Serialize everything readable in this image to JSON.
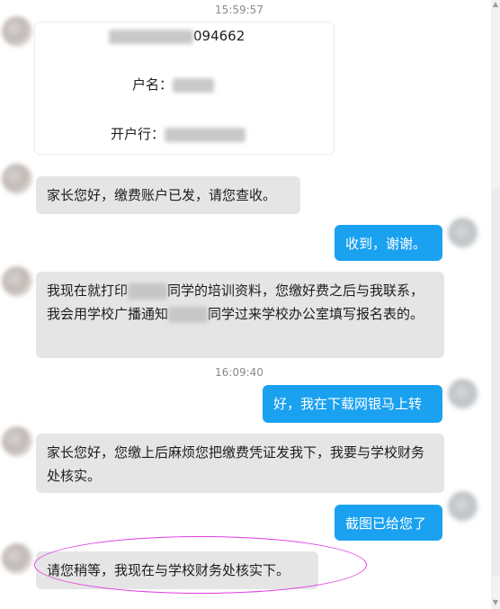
{
  "timestamps": [
    "15:59:57",
    "16:09:40"
  ],
  "card": {
    "account_suffix": "094662",
    "name_label": "户名：",
    "bank_label": "开户行："
  },
  "messages": [
    {
      "side": "in",
      "text": "家长您好，缴费账户已发，请您查收。"
    },
    {
      "side": "out",
      "text": "收到，谢谢。"
    },
    {
      "side": "in",
      "text_parts": [
        "我现在就打印",
        "同学的培训资料，您缴好费之后与我联系，我会用学校广播通知",
        "同学过来学校办公室填写报名表的。"
      ]
    },
    {
      "side": "out",
      "text": "好，我在下载网银马上转"
    },
    {
      "side": "in",
      "text": "家长您好，您缴上后麻烦您把缴费凭证发我下，我要与学校财务处核实。"
    },
    {
      "side": "out",
      "text": "截图已给您了"
    },
    {
      "side": "in",
      "text": "请您稍等，我现在与学校财务处核实下。"
    }
  ],
  "colors": {
    "incoming_bubble": "#e5e5e5",
    "outgoing_bubble": "#1aa1f0",
    "annotation": "#e23be2"
  },
  "icons": {
    "scroll_up": "scroll-up-icon",
    "scroll_down": "scroll-down-icon"
  }
}
